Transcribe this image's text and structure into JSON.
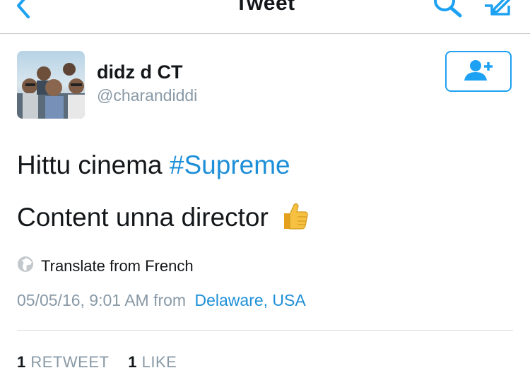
{
  "nav": {
    "title": "Tweet",
    "back_icon": "chevron-left-icon",
    "search_icon": "search-icon",
    "compose_icon": "compose-icon"
  },
  "author": {
    "display_name": "didz d CT",
    "handle": "@charandiddi",
    "follow_icon": "add-user-icon"
  },
  "tweet": {
    "line1_text": "Hittu cinema",
    "line1_hashtag": "#Supreme",
    "line2_text": "Content unna director",
    "emoji": "thumbs-up"
  },
  "translate": {
    "label": "Translate from French",
    "icon": "globe-icon"
  },
  "meta": {
    "timestamp": "05/05/16, 9:01 AM",
    "from_label": "from",
    "location": "Delaware, USA"
  },
  "stats": {
    "retweets_count": "1",
    "retweets_label": "RETWEET",
    "likes_count": "1",
    "likes_label": "LIKE"
  },
  "colors": {
    "accent": "#1da1f2",
    "link": "#1d8fd8",
    "muted": "#8899a6",
    "text": "#14171a"
  }
}
